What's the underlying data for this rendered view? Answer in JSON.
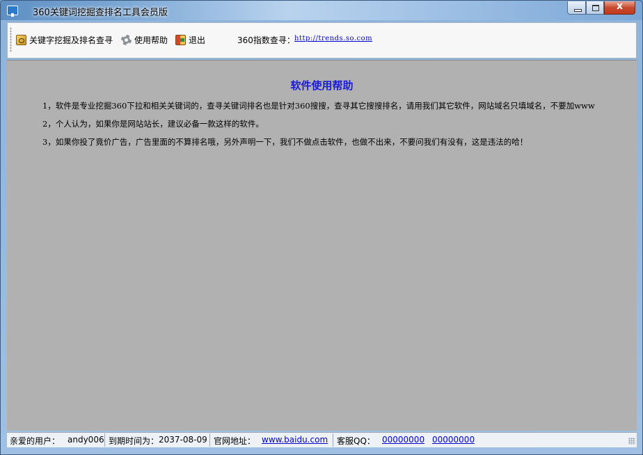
{
  "window": {
    "title": "360关键词挖掘查排名工具会员版",
    "close_glyph": "x"
  },
  "toolbar": {
    "keyword_button": "关键字挖掘及排名查寻",
    "help_button": "使用帮助",
    "exit_button": "退出",
    "index_label": "360指数查寻：",
    "index_link": "http://trends.so.com"
  },
  "help": {
    "title": "软件使用帮助",
    "lines": [
      "1，软件是专业挖掘360下拉和相关关键词的，查寻关键词排名也是针对360搜搜，查寻其它搜搜排名，请用我们其它软件，网站域名只填域名，不要加www",
      "2，个人认为，如果你是网站站长，建议必备一款这样的软件。",
      "3，如果你投了竟价广告，广告里面的不算排名哦，另外声明一下，我们不做点击软件，也做不出来，不要问我们有没有，这是违法的哈！"
    ]
  },
  "status": {
    "user_label": "亲爱的用户：",
    "user_name": "andy006",
    "expire_label": "到期时间为：",
    "expire_date": "2037-08-09",
    "site_label": "官网地址：",
    "site_link": "www.baidu.com",
    "qq_label": "客服QQ：",
    "qq1": "00000000",
    "qq2": "00000000"
  },
  "colors": {
    "content_bg": "#b1b1b1",
    "help_title": "#1a1ad6",
    "link": "#0000cc"
  },
  "icons": [
    "app-icon",
    "key-icon",
    "gear-icon",
    "exit-icon"
  ]
}
